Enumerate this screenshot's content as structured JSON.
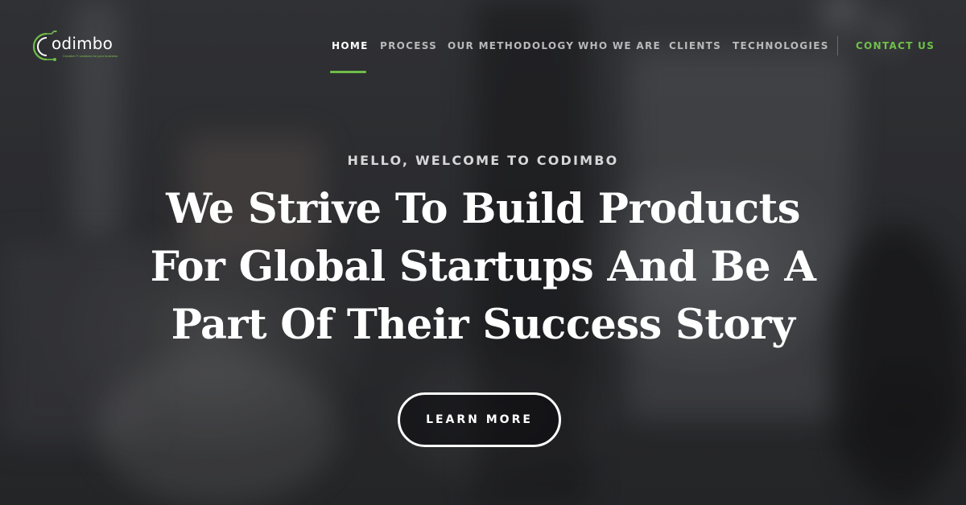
{
  "logo": {
    "wordmark": "odimbo",
    "tagline": "Creative IT solutions for your business"
  },
  "nav": {
    "items": [
      {
        "label": "HOME",
        "active": true
      },
      {
        "label": "PROCESS",
        "active": false
      },
      {
        "label": "OUR METHODOLOGY",
        "active": false
      },
      {
        "label": "WHO WE ARE",
        "active": false
      },
      {
        "label": "CLIENTS",
        "active": false
      },
      {
        "label": "TECHNOLOGIES",
        "active": false
      }
    ],
    "contact": "CONTACT US"
  },
  "hero": {
    "kicker": "HELLO, WELCOME TO CODIMBO",
    "headline_lines": [
      "We Strive To Build Products",
      "For Global Startups And Be A",
      "Part Of Their Success Story"
    ],
    "cta_label": "LEARN MORE"
  },
  "colors": {
    "accent_green": "#6fbd48",
    "text_white": "#ffffff",
    "nav_gray": "#b9b9bb"
  },
  "icons": {
    "logo_mark": "circuit-c-icon"
  }
}
